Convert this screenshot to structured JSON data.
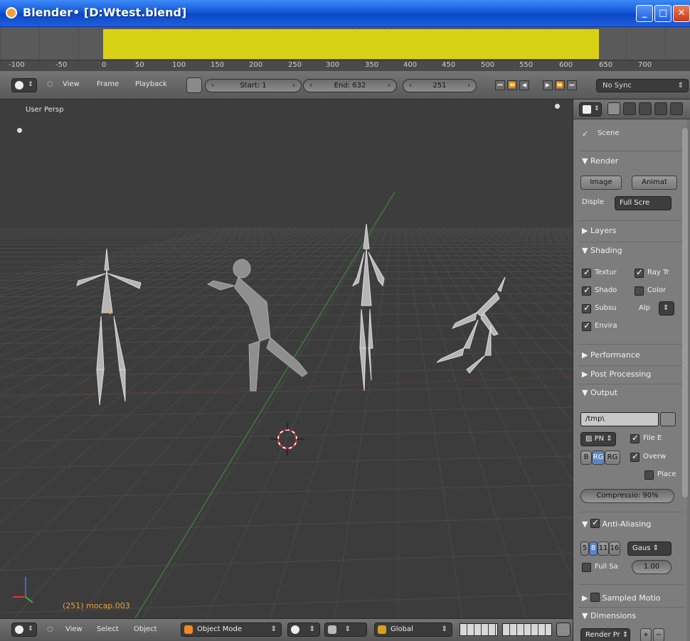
{
  "window": {
    "title": "Blender• [D:Wtest.blend]",
    "minimize": "_",
    "maximize": "□",
    "close": "✕"
  },
  "timeline": {
    "ruler_ticks": [
      "-100",
      "-50",
      "0",
      "50",
      "100",
      "150",
      "200",
      "250",
      "300",
      "350",
      "400",
      "450",
      "500",
      "550",
      "600",
      "650",
      "700"
    ],
    "range_color": "#d8d214"
  },
  "timeline_header": {
    "menu": [
      "View",
      "Frame",
      "Playback"
    ],
    "start_label": "Start: 1",
    "end_label": "End: 632",
    "current_frame": "251",
    "sync": "No Sync",
    "playback_icons": [
      "jump-start-icon",
      "prev-keyframe-icon",
      "play-reverse-icon",
      "play-icon",
      "next-keyframe-icon",
      "jump-end-icon"
    ]
  },
  "viewport": {
    "view_name": "User Persp",
    "active_object": "(251) mocap.003"
  },
  "view3d_header": {
    "menu": [
      "View",
      "Select",
      "Object"
    ],
    "mode": "Object Mode",
    "orientation": "Global"
  },
  "properties": {
    "scene_label": "Scene",
    "render": {
      "title": "Render",
      "image_btn": "Image",
      "anim_btn": "Animat",
      "display_label": "Disple",
      "display_value": "Full Scre"
    },
    "layers": "Layers",
    "shading": {
      "title": "Shading",
      "texture": "Textur",
      "ray": "Ray Tr",
      "shadow": "Shado",
      "color": "Color",
      "subsurface": "Subsu",
      "alpha": "Alp",
      "envmap": "Envira"
    },
    "performance": "Performance",
    "post_processing": "Post Processing",
    "output": {
      "title": "Output",
      "path": "/tmp\\",
      "format": "PN",
      "file_ext": "File E",
      "overwrite": "Overw",
      "placeholders": "Place",
      "bw": "B",
      "rgb": "RG",
      "rgba": "RG",
      "compression": "Compressio: 90%"
    },
    "anti_aliasing": {
      "title": "Anti-Aliasing",
      "samples": [
        "5",
        "8",
        "11",
        "16"
      ],
      "filter": "Gaus",
      "full_sample": "Full Sa",
      "size": "1.00"
    },
    "sampled_motion": "Sampled Motio",
    "dimensions": "Dimensions",
    "render_preset": "Render Pr"
  }
}
